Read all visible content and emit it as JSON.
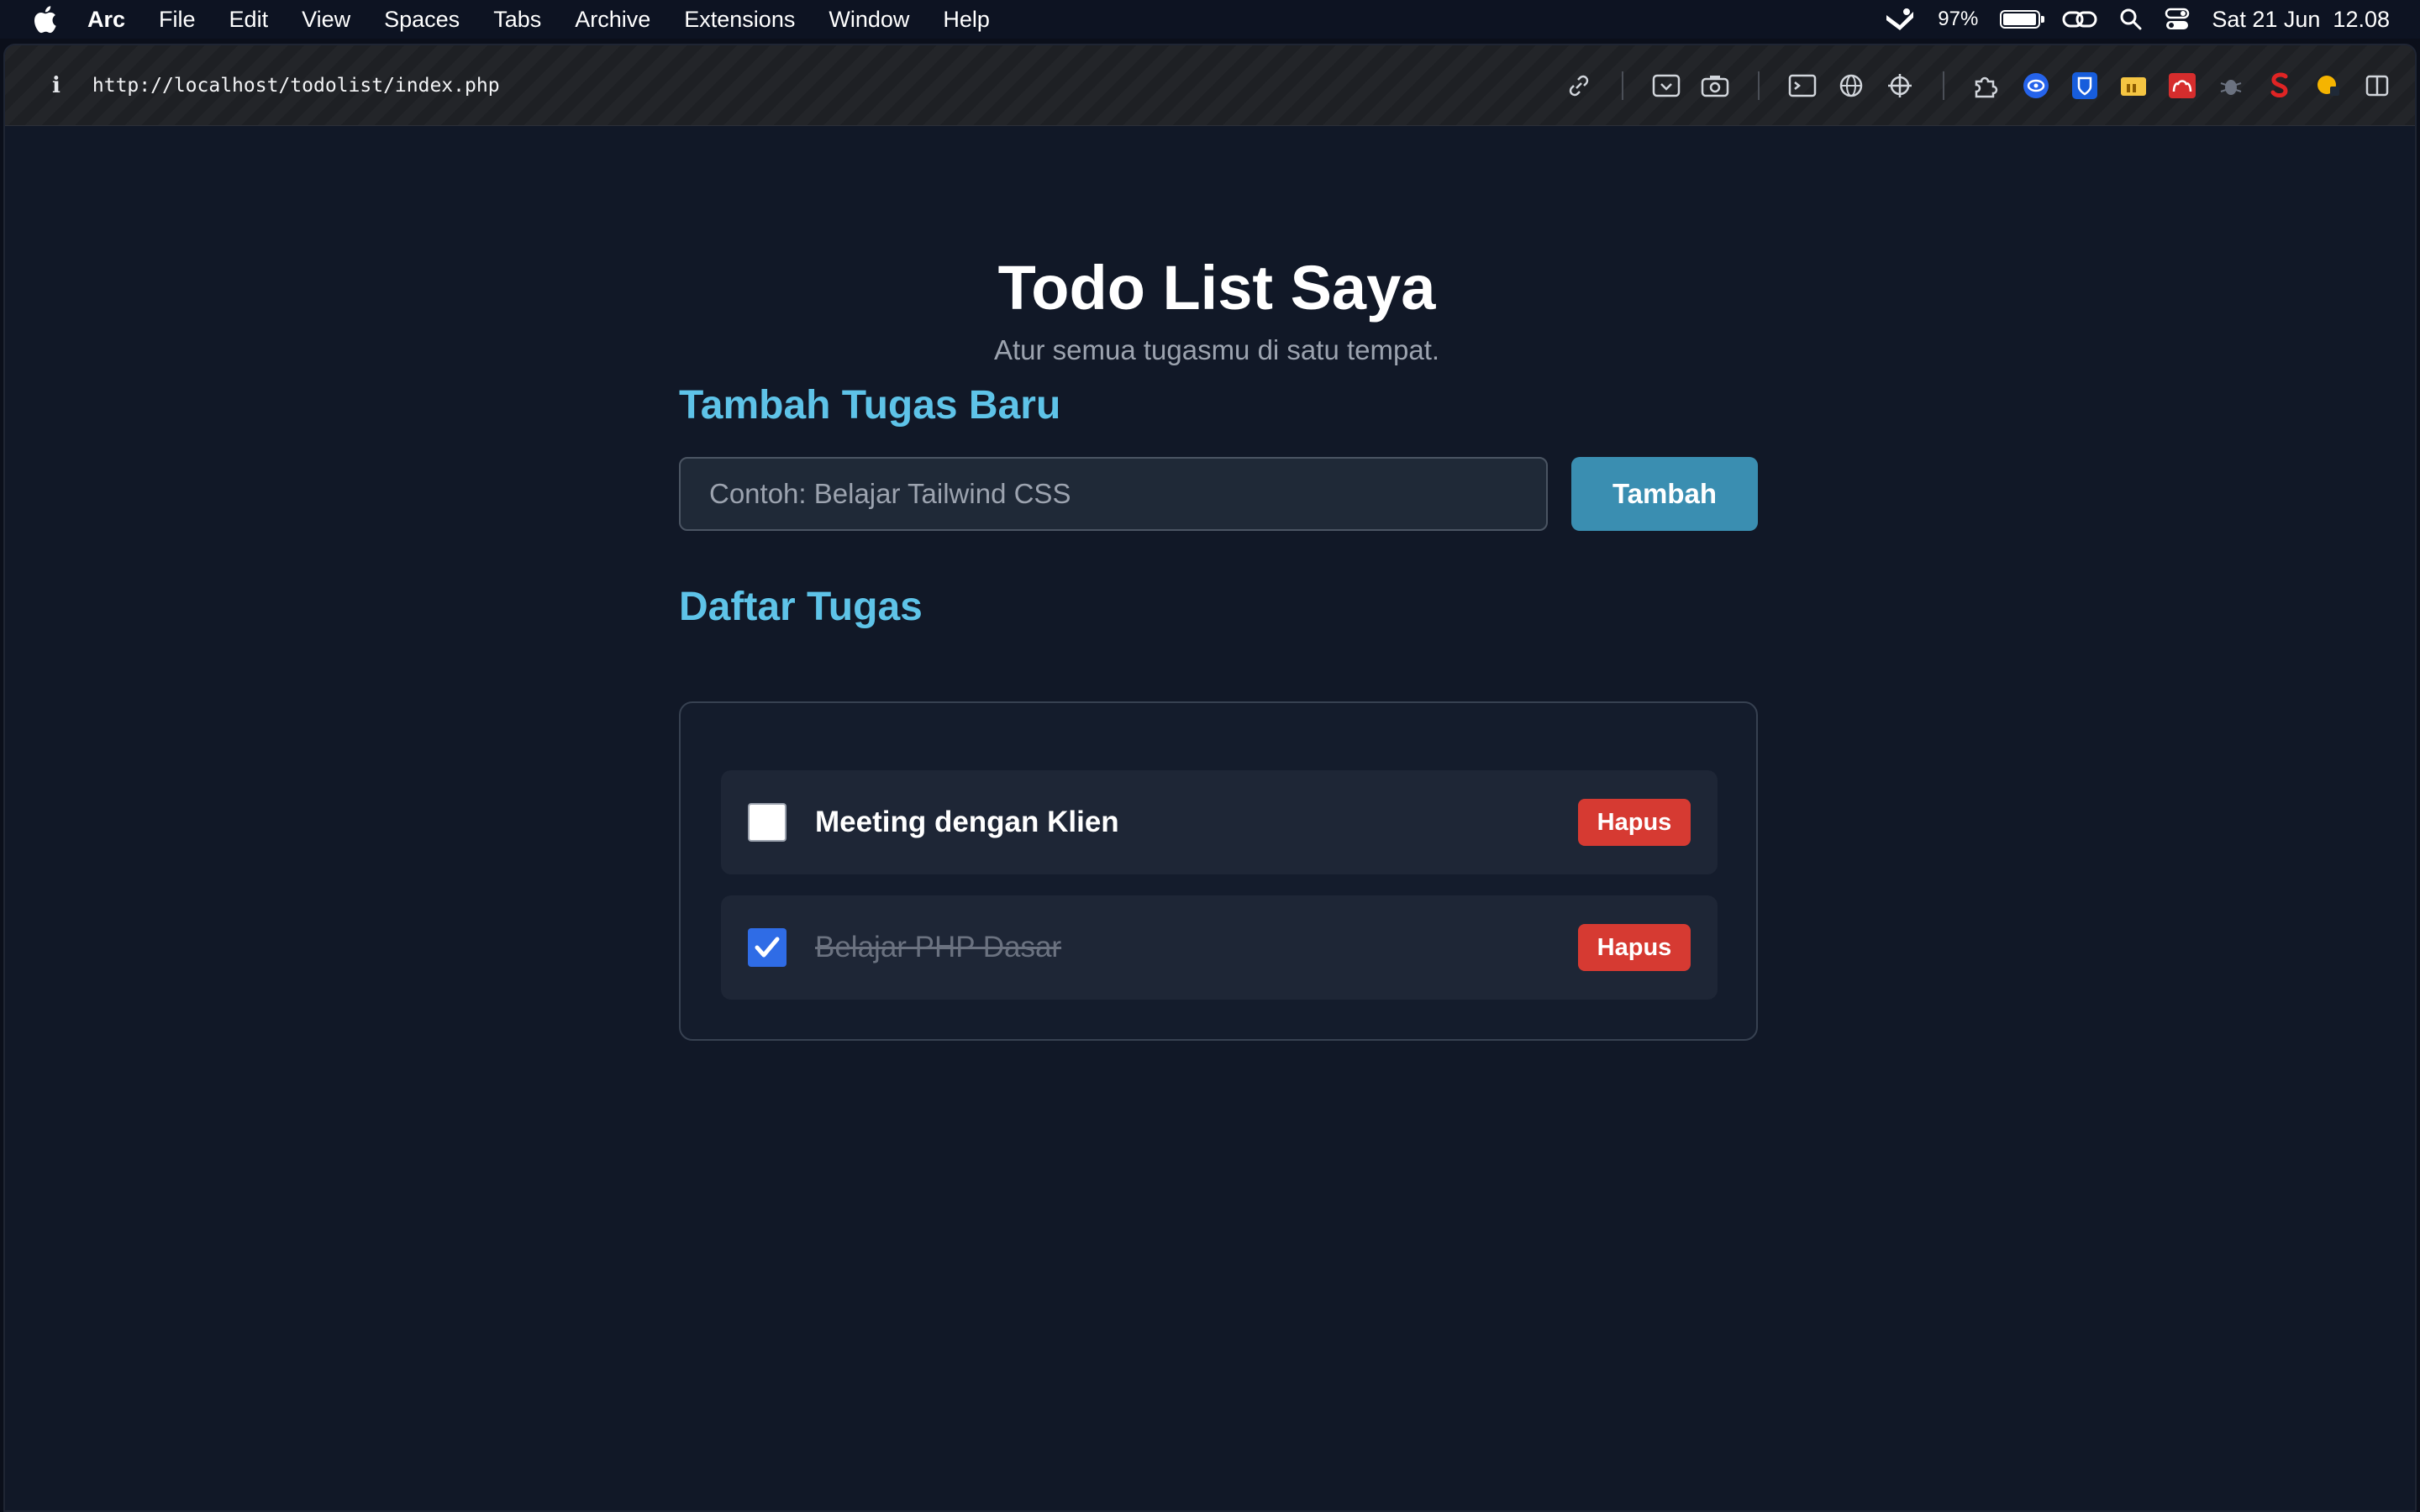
{
  "menubar": {
    "app_name": "Arc",
    "items": [
      "File",
      "Edit",
      "View",
      "Spaces",
      "Tabs",
      "Archive",
      "Extensions",
      "Window",
      "Help"
    ],
    "battery_percent": "97%",
    "battery_level": 0.97,
    "datetime": "Sat 21 Jun  12.08"
  },
  "browser": {
    "url": "http://localhost/todolist/index.php",
    "info_icon": "i"
  },
  "page": {
    "title": "Todo List Saya",
    "subtitle": "Atur semua tugasmu di satu tempat.",
    "add_section_title": "Tambah Tugas Baru",
    "input_placeholder": "Contoh: Belajar Tailwind CSS",
    "input_value": "",
    "add_button_label": "Tambah",
    "list_section_title": "Daftar Tugas",
    "tasks": [
      {
        "label": "Meeting dengan Klien",
        "done": false,
        "delete_label": "Hapus"
      },
      {
        "label": "Belajar PHP Dasar",
        "done": true,
        "delete_label": "Hapus"
      }
    ]
  },
  "colors": {
    "accent_heading": "#5ec3e8",
    "add_button": "#3a8eb1",
    "delete_button": "#d63a32",
    "checkbox_checked": "#2f6ce6",
    "background": "#111827"
  }
}
